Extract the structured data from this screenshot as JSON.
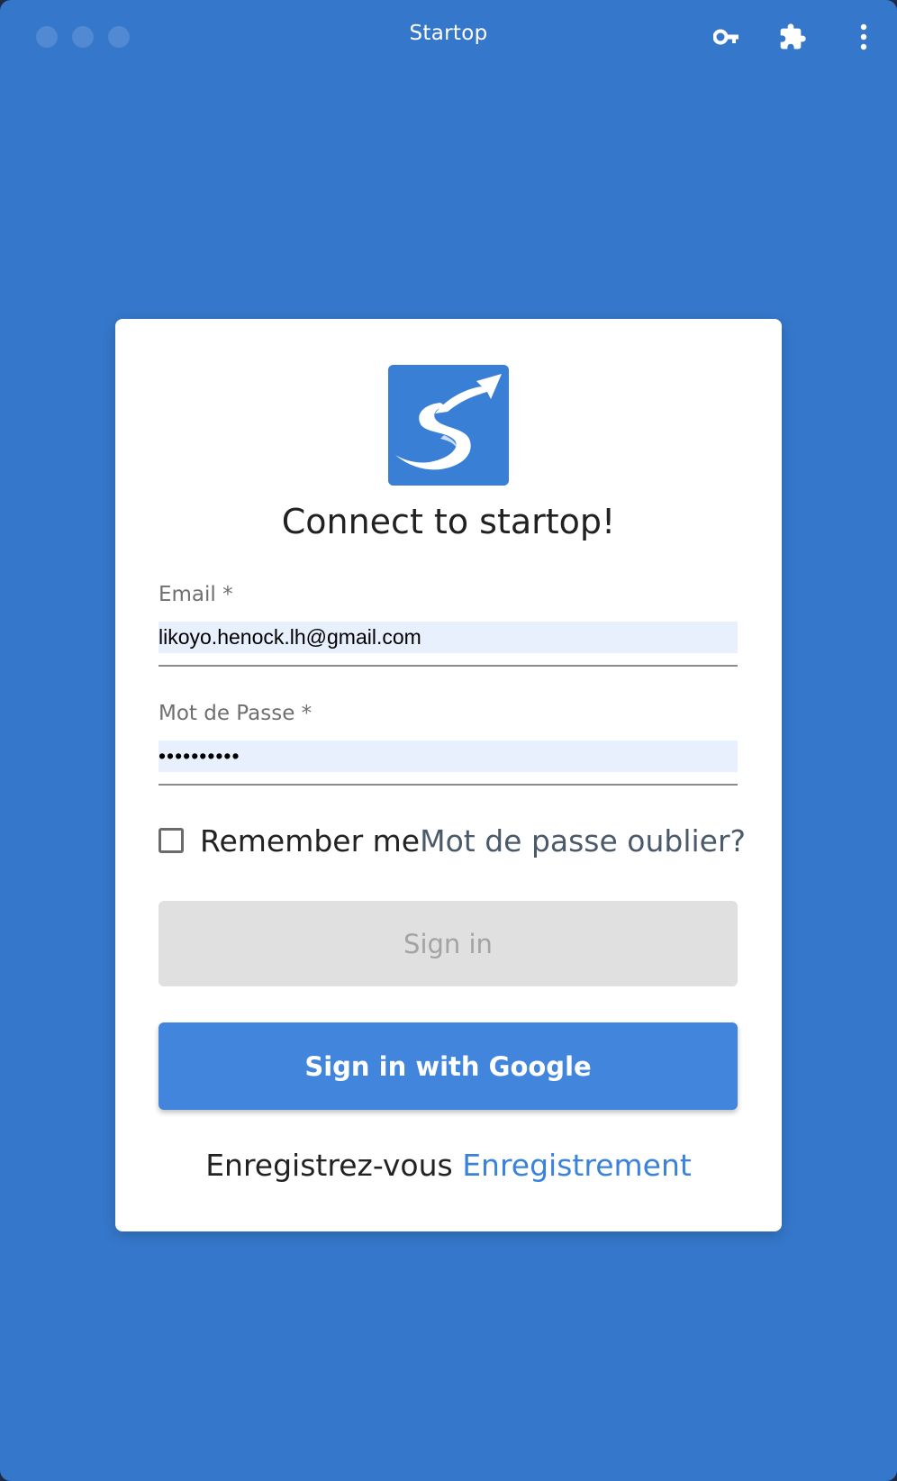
{
  "window": {
    "title": "Startop"
  },
  "toolbar": {
    "icons": [
      "key-icon",
      "puzzle-icon",
      "more-vertical-icon"
    ]
  },
  "login": {
    "heading": "Connect to startop!",
    "email_label": "Email *",
    "email_value": "likoyo.henock.lh@gmail.com",
    "password_label": "Mot de Passe *",
    "password_value": "••••••••••",
    "remember_label": "Remember me",
    "forgot_link": "Mot de passe oublier?",
    "signin_button": "Sign in",
    "google_button": "Sign in with Google",
    "register_prompt": "Enregistrez-vous",
    "register_link": "Enregistrement"
  },
  "colors": {
    "background": "#3577cb",
    "card": "#ffffff",
    "accent": "#4186dc",
    "input_fill": "#e8f0fe",
    "disabled_button": "#e0e0e0"
  }
}
